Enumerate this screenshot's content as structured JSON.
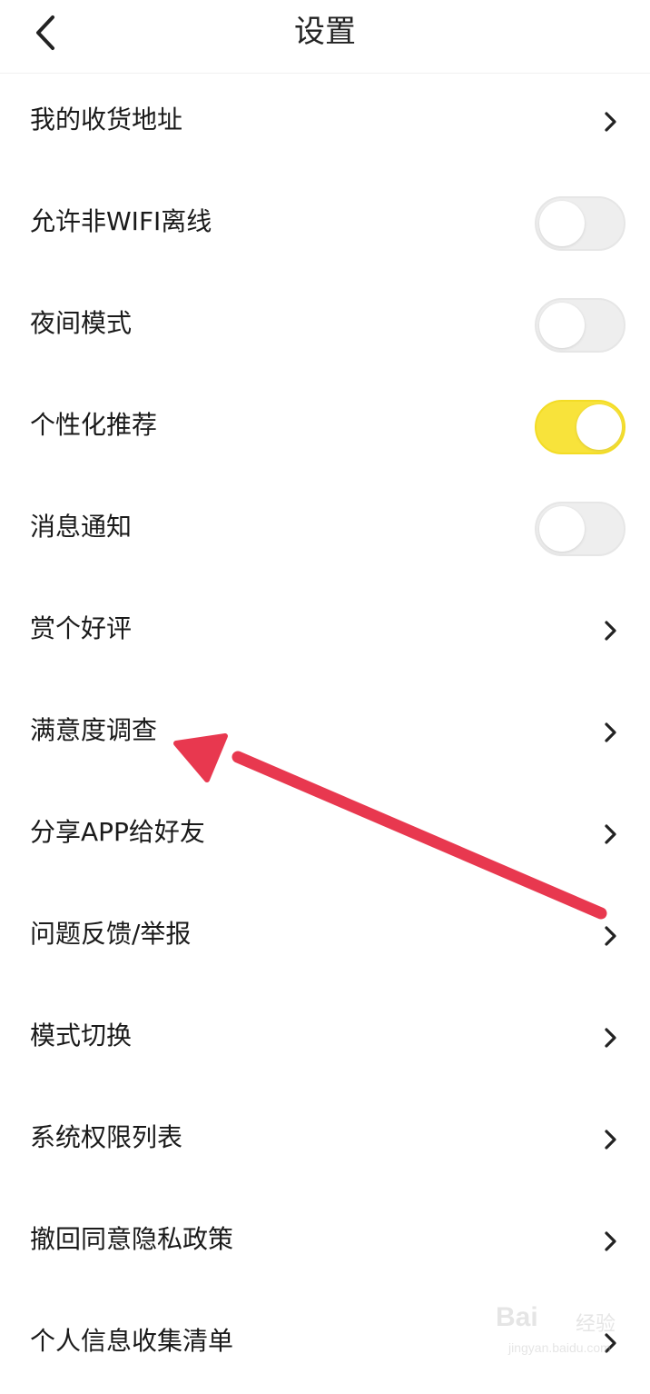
{
  "header": {
    "title": "设置",
    "back_icon": "chevron-left-icon"
  },
  "settings": [
    {
      "label": "我的收货地址",
      "type": "link"
    },
    {
      "label": "允许非WIFI离线",
      "type": "toggle",
      "on": false
    },
    {
      "label": "夜间模式",
      "type": "toggle",
      "on": false
    },
    {
      "label": "个性化推荐",
      "type": "toggle",
      "on": true
    },
    {
      "label": "消息通知",
      "type": "toggle",
      "on": false
    },
    {
      "label": "赏个好评",
      "type": "link"
    },
    {
      "label": "满意度调查",
      "type": "link"
    },
    {
      "label": "分享APP给好友",
      "type": "link"
    },
    {
      "label": "问题反馈/举报",
      "type": "link"
    },
    {
      "label": "模式切换",
      "type": "link"
    },
    {
      "label": "系统权限列表",
      "type": "link"
    },
    {
      "label": "撤回同意隐私政策",
      "type": "link"
    },
    {
      "label": "个人信息收集清单",
      "type": "link"
    }
  ],
  "colors": {
    "toggle_on": "#f8e33b",
    "toggle_off": "#eeeeee",
    "annotation_arrow": "#e8384f"
  },
  "watermark": {
    "brand": "Bai",
    "name": "经验",
    "url": "jingyan.baidu.com"
  }
}
